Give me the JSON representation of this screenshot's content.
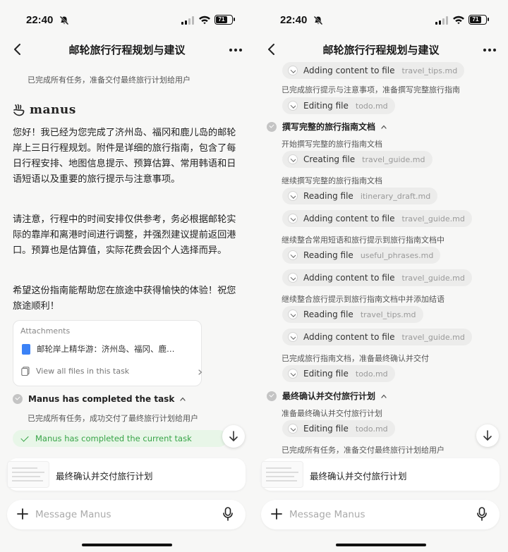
{
  "status": {
    "time": "22:40",
    "battery": "71"
  },
  "header": {
    "title": "邮轮旅行行程规划与建议"
  },
  "left": {
    "top_status": "已完成所有任务，准备交付最终旅行计划给用户",
    "logo_name": "manus",
    "paragraphs": [
      "您好！我已经为您完成了济州岛、福冈和鹿儿岛的邮轮岸上三日行程规划。附件是详细的旅行指南，包含了每日行程安排、地图信息提示、预算估算、常用韩语和日语短语以及重要的旅行提示与注意事项。",
      "请注意，行程中的时间安排仅供参考，务必根据邮轮实际的靠岸和离港时间进行调整，并强烈建议提前返回港口。预算也是估算值，实际花费会因个人选择而异。",
      "希望这份指南能帮助您在旅途中获得愉快的体验！祝您旅途顺利！"
    ],
    "attachments": {
      "label": "Attachments",
      "file_name": "邮轮岸上精华游：济州岛、福冈、鹿…",
      "view_all": "View all files in this task"
    },
    "completed_step": {
      "label": "Manus has completed the task",
      "detail": "已完成所有任务，成功交付了最终旅行计划给用户"
    },
    "done_banner": "Manus has completed the current task"
  },
  "right": {
    "items": [
      {
        "type": "pill",
        "action": "Adding content to file",
        "file": "travel_tips.md"
      },
      {
        "type": "sub",
        "text": "已完成旅行提示与注意事项，准备撰写完整旅行指南"
      },
      {
        "type": "pill",
        "action": "Editing file",
        "file": "todo.md"
      },
      {
        "type": "head",
        "text": "撰写完整的旅行指南文档"
      },
      {
        "type": "sub",
        "text": "开始撰写完整的旅行指南文档"
      },
      {
        "type": "pill",
        "action": "Creating file",
        "file": "travel_guide.md"
      },
      {
        "type": "sub",
        "text": "继续撰写完整的旅行指南文档"
      },
      {
        "type": "pill",
        "action": "Reading file",
        "file": "itinerary_draft.md"
      },
      {
        "type": "pill",
        "action": "Adding content to file",
        "file": "travel_guide.md"
      },
      {
        "type": "sub",
        "text": "继续整合常用短语和旅行提示到旅行指南文档中"
      },
      {
        "type": "pill",
        "action": "Reading file",
        "file": "useful_phrases.md"
      },
      {
        "type": "pill",
        "action": "Adding content to file",
        "file": "travel_guide.md"
      },
      {
        "type": "sub",
        "text": "继续整合旅行提示到旅行指南文档中并添加结语"
      },
      {
        "type": "pill",
        "action": "Reading file",
        "file": "travel_tips.md"
      },
      {
        "type": "pill",
        "action": "Adding content to file",
        "file": "travel_guide.md"
      },
      {
        "type": "sub",
        "text": "已完成旅行指南文档，准备最终确认并交付"
      },
      {
        "type": "pill",
        "action": "Editing file",
        "file": "todo.md"
      },
      {
        "type": "head",
        "text": "最终确认并交付旅行计划"
      },
      {
        "type": "sub",
        "text": "准备最终确认并交付旅行计划"
      },
      {
        "type": "pill",
        "action": "Editing file",
        "file": "todo.md"
      },
      {
        "type": "sub",
        "text": "已完成所有任务，准备交付最终旅行计划给用户"
      }
    ]
  },
  "task_card": {
    "name": "最终确认并交付旅行计划"
  },
  "composer": {
    "placeholder": "Message Manus"
  },
  "colors": {
    "accent_green": "#37a447",
    "doc_blue": "#3b82f6",
    "background": "#f7f7f6"
  }
}
